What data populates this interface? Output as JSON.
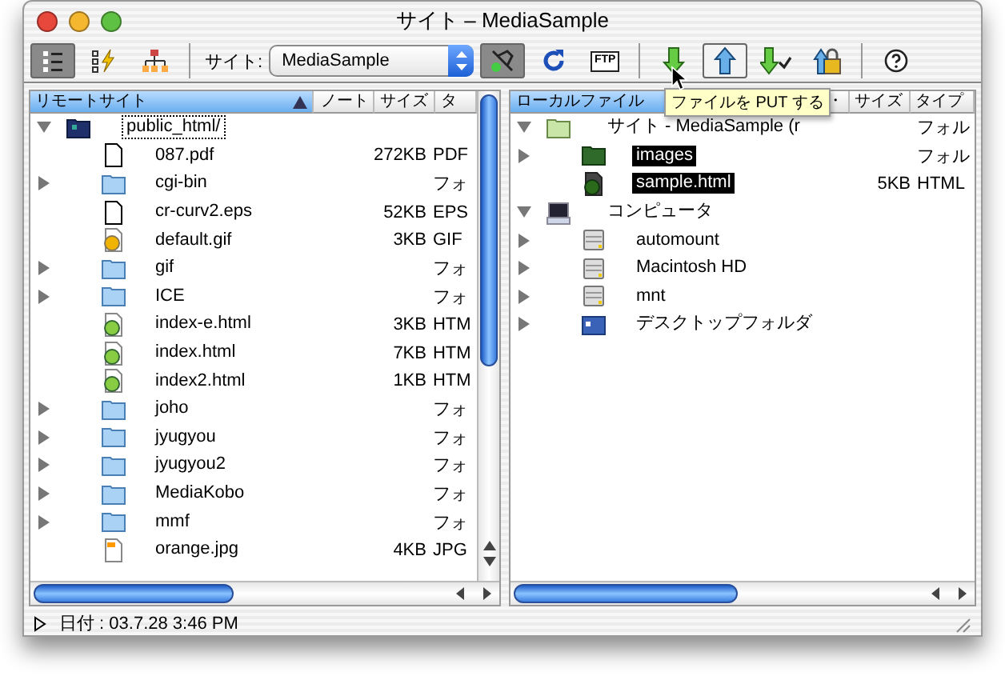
{
  "window": {
    "title": "サイト – MediaSample"
  },
  "toolbar": {
    "buttons": [
      {
        "kind": "list-view",
        "selected": true,
        "hovered": false
      },
      {
        "kind": "bolt-view",
        "selected": false,
        "hovered": false
      },
      {
        "kind": "tree-view",
        "selected": false,
        "hovered": false
      },
      {
        "kind": "site-select"
      },
      {
        "kind": "connect",
        "selected": true,
        "hovered": false
      },
      {
        "kind": "refresh",
        "selected": false,
        "hovered": false
      },
      {
        "kind": "ftp",
        "selected": false,
        "hovered": false,
        "label": "FTP"
      },
      {
        "kind": "separator"
      },
      {
        "kind": "download",
        "selected": false,
        "hovered": false
      },
      {
        "kind": "upload",
        "selected": false,
        "hovered": true
      },
      {
        "kind": "download-check",
        "selected": false,
        "hovered": false
      },
      {
        "kind": "lock-upload",
        "selected": false,
        "hovered": false
      },
      {
        "kind": "separator"
      },
      {
        "kind": "help",
        "selected": false,
        "hovered": false
      }
    ],
    "site_label": "サイト:",
    "site_value": "MediaSample"
  },
  "tooltip": "ファイルを PUT する",
  "remote": {
    "columns": [
      "リモートサイト",
      "ノート",
      "サイズ",
      "タ"
    ],
    "sorted_column_selected": true,
    "tree": [
      {
        "name": "public_html/",
        "kind": "site-folder",
        "expanded": true,
        "selected": false,
        "focused": true,
        "children": [
          {
            "name": "087.pdf",
            "kind": "file",
            "size": "272KB",
            "type": "PDF",
            "selected": false,
            "focused": false
          },
          {
            "name": "cgi-bin",
            "kind": "folder",
            "type": "フォ",
            "expanded": false,
            "selected": false,
            "focused": false
          },
          {
            "name": "cr-curv2.eps",
            "kind": "file",
            "size": "52KB",
            "type": "EPS",
            "selected": false,
            "focused": false
          },
          {
            "name": "default.gif",
            "kind": "gif",
            "size": "3KB",
            "type": "GIF",
            "selected": false,
            "focused": false
          },
          {
            "name": "gif",
            "kind": "folder",
            "type": "フォ",
            "expanded": false,
            "selected": false,
            "focused": false
          },
          {
            "name": "ICE",
            "kind": "folder",
            "type": "フォ",
            "expanded": false,
            "selected": false,
            "focused": false
          },
          {
            "name": "index-e.html",
            "kind": "html",
            "size": "3KB",
            "type": "HTM",
            "selected": false,
            "focused": false
          },
          {
            "name": "index.html",
            "kind": "html",
            "size": "7KB",
            "type": "HTM",
            "selected": false,
            "focused": false
          },
          {
            "name": "index2.html",
            "kind": "html",
            "size": "1KB",
            "type": "HTM",
            "selected": false,
            "focused": false
          },
          {
            "name": "joho",
            "kind": "folder",
            "type": "フォ",
            "expanded": false,
            "selected": false,
            "focused": false
          },
          {
            "name": "jyugyou",
            "kind": "folder",
            "type": "フォ",
            "expanded": false,
            "selected": false,
            "focused": false
          },
          {
            "name": "jyugyou2",
            "kind": "folder",
            "type": "フォ",
            "expanded": false,
            "selected": false,
            "focused": false
          },
          {
            "name": "MediaKobo",
            "kind": "folder",
            "type": "フォ",
            "expanded": false,
            "selected": false,
            "focused": false
          },
          {
            "name": "mmf",
            "kind": "folder",
            "type": "フォ",
            "expanded": false,
            "selected": false,
            "focused": false
          },
          {
            "name": "orange.jpg",
            "kind": "image",
            "size": "4KB",
            "type": "JPG",
            "selected": false,
            "focused": false
          }
        ]
      }
    ]
  },
  "local": {
    "columns": [
      "ローカルファイル",
      "・",
      "サイズ",
      "タイプ"
    ],
    "sorted_column_selected": true,
    "tree": [
      {
        "name": "サイト - MediaSample (r",
        "kind": "local-folder",
        "type": "フォル",
        "expanded": true,
        "selected": false,
        "focused": false,
        "children": [
          {
            "name": "images",
            "kind": "green-folder",
            "type": "フォル",
            "expanded": false,
            "selected": true,
            "focused": false
          },
          {
            "name": "sample.html",
            "kind": "html-dark",
            "size": "5KB",
            "type": "HTML",
            "selected": true,
            "focused": false
          }
        ]
      },
      {
        "name": "コンピュータ",
        "kind": "computer",
        "expanded": true,
        "selected": false,
        "focused": false,
        "children": [
          {
            "name": "automount",
            "kind": "disk",
            "expanded": false,
            "selected": false,
            "focused": false
          },
          {
            "name": "Macintosh HD",
            "kind": "disk",
            "expanded": false,
            "selected": false,
            "focused": false
          },
          {
            "name": "mnt",
            "kind": "disk",
            "expanded": false,
            "selected": false,
            "focused": false
          },
          {
            "name": "デスクトップフォルダ",
            "kind": "desktop",
            "expanded": false,
            "selected": false,
            "focused": false
          }
        ]
      }
    ]
  },
  "status_bar": {
    "text": "日付 : 03.7.28 3:46 PM",
    "expanded": false
  }
}
